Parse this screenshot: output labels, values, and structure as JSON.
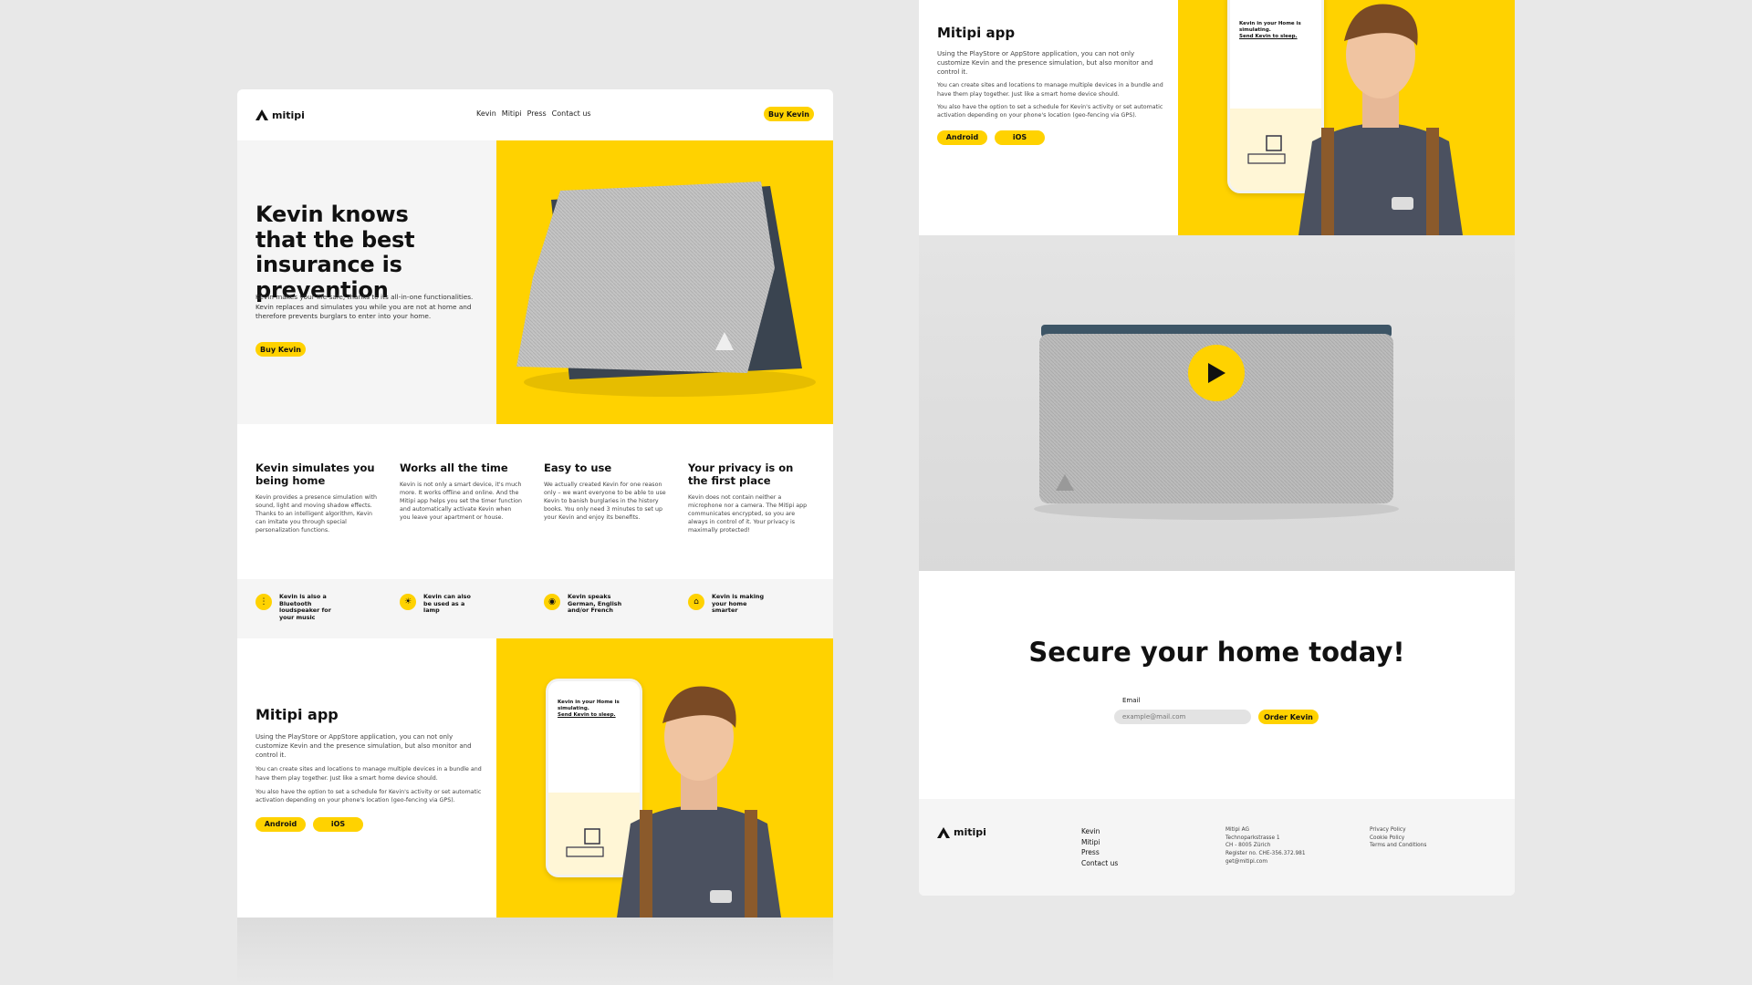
{
  "brand": {
    "name": "mitipi"
  },
  "nav": {
    "items": [
      "Kevin",
      "Mitipi",
      "Press",
      "Contact us"
    ],
    "cta": "Buy Kevin"
  },
  "hero": {
    "title": "Kevin knows that the best insurance is prevention",
    "text": "Kevin makes your life safe, thanks to its all-in-one functionalities. Kevin replaces and simulates you while you are not at home and therefore prevents burglars to enter into your home.",
    "cta": "Buy Kevin"
  },
  "features": [
    {
      "title": "Kevin simulates you being home",
      "text": "Kevin provides a presence simulation with sound, light and moving shadow effects. Thanks to an intelligent algorithm, Kevin can imitate you through special personalization functions."
    },
    {
      "title": "Works all the time",
      "text": "Kevin is not only a smart device, it's much more. It works offline and online. And the Mitipi app helps you set the timer function and automatically activate Kevin when you leave your apartment or house."
    },
    {
      "title": "Easy to use",
      "text": "We actually created Kevin for one reason only – we want everyone to be able to use Kevin to banish burglaries in the history books. You only need 3 minutes to set up your Kevin and enjoy its benefits."
    },
    {
      "title": "Your privacy is on the first place",
      "text": "Kevin does not contain neither a microphone nor a camera. The Mitipi app communicates encrypted, so you are always in control of it. Your privacy is maximally protected!"
    }
  ],
  "badges": [
    {
      "icon": "bluetooth-icon",
      "text": "Kevin is also a Bluetooth loudspeaker for your music"
    },
    {
      "icon": "lamp-icon",
      "text": "Kevin can also be used as a lamp"
    },
    {
      "icon": "language-icon",
      "text": "Kevin speaks German, English and/or French"
    },
    {
      "icon": "home-icon",
      "text": "Kevin is making your home smarter"
    }
  ],
  "app": {
    "title": "Mitipi app",
    "p1": "Using the PlayStore or AppStore application, you can not only customize Kevin and the presence simulation, but also monitor and control it.",
    "p2": "You can create sites and locations to manage multiple devices in a bundle and have them play together. Just like a smart home device should.",
    "p3": "You also have the option to set a schedule for Kevin's activity or set automatic activation depending on your phone's location (geo-fencing via GPS).",
    "android": "Android",
    "ios": "iOS",
    "phone_line1": "Kevin in your Home is simulating.",
    "phone_line2": "Send Kevin to sleep."
  },
  "cta_section": {
    "title": "Secure your home today!",
    "email_label": "Email",
    "email_placeholder": "example@mail.com",
    "button": "Order Kevin"
  },
  "footer": {
    "links": [
      "Kevin",
      "Mitipi",
      "Press",
      "Contact us"
    ],
    "address": [
      "Mitipi AG",
      "Technoparkstrasse 1",
      "CH - 8005 Zürich",
      "Register no. CHE-356.372.981",
      "get@mitipi.com"
    ],
    "legal": [
      "Privacy Policy",
      "Cookie Policy",
      "Terms and Conditions"
    ]
  },
  "colors": {
    "accent": "#ffd200",
    "background": "#e8e8e8",
    "panel": "#ffffff",
    "light_gray": "#f5f5f5"
  }
}
